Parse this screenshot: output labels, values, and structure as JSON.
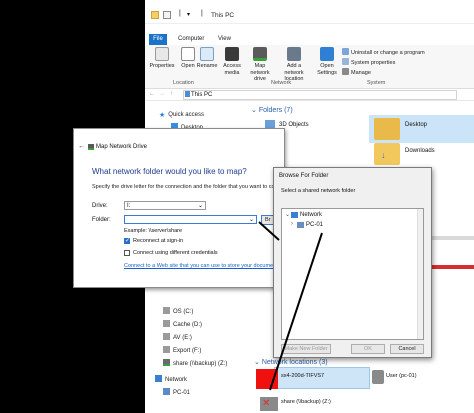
{
  "explorer": {
    "window_title": "This PC",
    "tabs": [
      "File",
      "Computer",
      "View"
    ],
    "ribbon": {
      "properties": "Properties",
      "open": "Open",
      "rename": "Rename",
      "access_media": "Access media",
      "map_network_drive": "Map network drive",
      "add_network_location": "Add a network location",
      "open_settings": "Open Settings",
      "uninstall": "Uninstall or change a program",
      "system_properties": "System properties",
      "manage": "Manage",
      "group_location": "Location",
      "group_network": "Network",
      "group_system": "System"
    },
    "address": "This PC",
    "nav": {
      "quick_access": "Quick access",
      "desktop": "Desktop",
      "os": "OS (C:)",
      "cache": "Cache (D:)",
      "av": "AV (E:)",
      "export": "Export (F:)",
      "share": "share (\\\\backup) (Z:)",
      "network": "Network",
      "pc01": "PC-01"
    },
    "folders_header": "Folders (7)",
    "folders": [
      "3D Objects",
      "Desktop",
      "Downloads"
    ],
    "network_header": "Network locations (3)",
    "network_items": [
      "sx4-200d-TIFVS7",
      "User (pc-01)",
      "share (\\\\backup) (Z:)"
    ]
  },
  "map_dialog": {
    "title": "Map Network Drive",
    "heading": "What network folder would you like to map?",
    "subtext": "Specify the drive letter for the connection and the folder that you want to conn",
    "drive_label": "Drive:",
    "drive_value": "I:",
    "folder_label": "Folder:",
    "folder_value": "",
    "browse_label": "Br",
    "example": "Example: \\\\server\\share",
    "reconnect": "Reconnect at sign-in",
    "reconnect_checked": true,
    "diff_creds": "Connect using different credentials",
    "diff_creds_checked": false,
    "link": "Connect to a Web site that you can use to store your document"
  },
  "browse_dialog": {
    "title": "Browse For Folder",
    "subtitle": "Select a shared network folder",
    "tree_root": "Network",
    "tree_child": "PC-01",
    "make_new_folder": "Make New Folder",
    "ok": "OK",
    "cancel": "Cancel"
  }
}
